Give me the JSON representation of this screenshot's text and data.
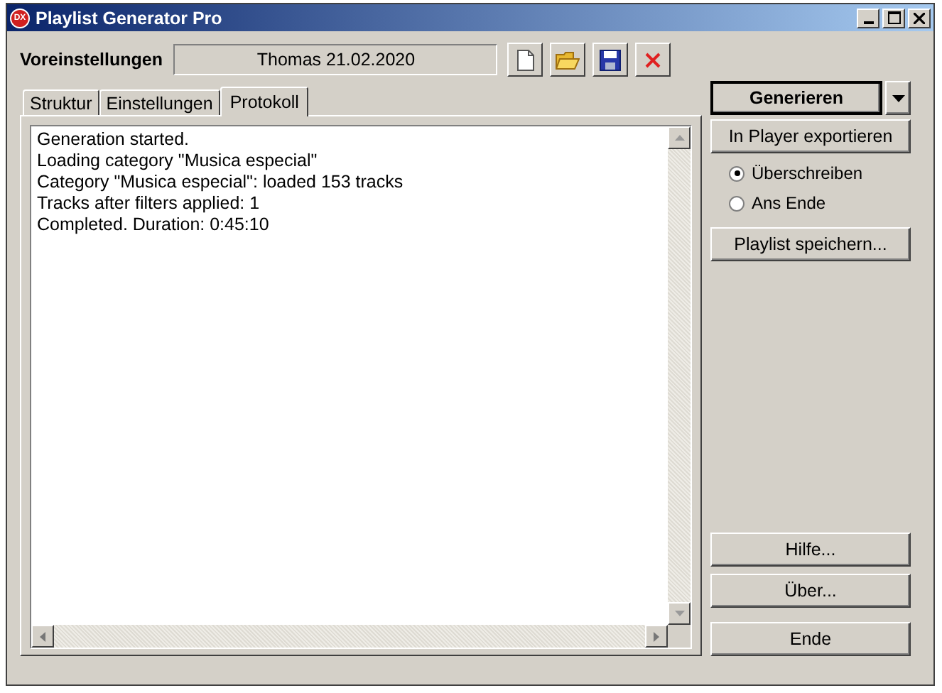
{
  "window": {
    "title": "Playlist Generator Pro",
    "logo": "DX"
  },
  "presets": {
    "label": "Voreinstellungen",
    "value": "Thomas 21.02.2020"
  },
  "tabs": [
    {
      "label": "Struktur",
      "selected": false
    },
    {
      "label": "Einstellungen",
      "selected": false
    },
    {
      "label": "Protokoll",
      "selected": true
    }
  ],
  "log": [
    "Generation started.",
    "Loading category \"Musica especial\"",
    "Category \"Musica especial\": loaded 153 tracks",
    "Tracks after filters applied: 1",
    "Completed. Duration: 0:45:10"
  ],
  "generate_button": "Generieren",
  "export_button": "In Player exportieren",
  "export_mode": [
    {
      "label": "Überschreiben",
      "selected": true
    },
    {
      "label": "Ans Ende",
      "selected": false
    }
  ],
  "save_button": "Playlist speichern...",
  "bottom_buttons": [
    "Hilfe...",
    "Über...",
    "Ende"
  ]
}
